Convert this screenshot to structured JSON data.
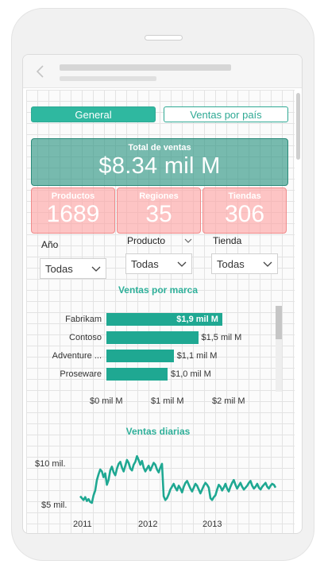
{
  "tabs": {
    "general": "General",
    "ventas_pais": "Ventas por país"
  },
  "kpis": {
    "total": {
      "label": "Total de ventas",
      "value": "$8.34 mil M"
    },
    "productos": {
      "label": "Productos",
      "value": "1689"
    },
    "regiones": {
      "label": "Regiones",
      "value": "35"
    },
    "tiendas": {
      "label": "Tiendas",
      "value": "306"
    }
  },
  "slicers": {
    "anio": {
      "label": "Año",
      "value": "Todas"
    },
    "producto": {
      "label": "Producto",
      "value": "Todas"
    },
    "tienda": {
      "label": "Tienda",
      "value": "Todas"
    }
  },
  "colors": {
    "accent": "#2fb8a0",
    "bar": "#1fa892",
    "kpi_total_bg": "#5fb0a2",
    "kpi_small_bg": "#ffb3b3"
  },
  "chart_data": [
    {
      "type": "bar",
      "title": "Ventas por marca",
      "categories": [
        "Fabrikam",
        "Contoso",
        "Adventure ...",
        "Proseware"
      ],
      "values": [
        1.9,
        1.5,
        1.1,
        1.0
      ],
      "value_labels": [
        "$1,9 mil M",
        "$1,5 mil M",
        "$1,1 mil M",
        "$1,0 mil M"
      ],
      "x_ticks": [
        "$0 mil M",
        "$1 mil M",
        "$2 mil M"
      ],
      "xlim": [
        0,
        2.3
      ],
      "orientation": "horizontal"
    },
    {
      "type": "line",
      "title": "Ventas diarias",
      "y_ticks": [
        "$10 mil.",
        "$5 mil."
      ],
      "x_ticks": [
        "2011",
        "2012",
        "2013"
      ],
      "ylim": [
        4,
        11
      ],
      "series": [
        {
          "values": [
            6.2,
            6.0,
            5.8,
            6.1,
            5.7,
            5.9,
            5.6,
            5.5,
            6.3,
            6.8,
            7.9,
            8.5,
            9.0,
            8.8,
            8.2,
            8.6,
            7.4,
            7.9,
            8.9,
            9.3,
            8.7,
            8.4,
            9.1,
            9.6,
            9.8,
            9.2,
            8.8,
            9.4,
            10.0,
            9.7,
            9.1,
            8.9,
            9.5,
            9.8,
            10.4,
            10.0,
            9.5,
            9.9,
            9.2,
            8.8,
            9.1,
            9.4,
            8.9,
            9.3,
            9.7,
            9.5,
            9.0,
            8.7,
            9.2,
            9.6,
            6.2,
            5.8,
            6.0,
            6.4,
            6.9,
            7.2,
            7.5,
            7.1,
            6.8,
            7.3,
            7.0,
            6.6,
            7.2,
            7.6,
            7.8,
            7.4,
            7.0,
            6.7,
            7.1,
            7.5,
            7.3,
            6.9,
            6.5,
            6.9,
            7.3,
            7.6,
            7.4,
            7.1,
            6.0,
            5.8,
            6.1,
            6.3,
            6.9,
            7.4,
            7.2,
            6.8,
            7.1,
            7.5,
            7.0,
            6.7,
            7.2,
            7.6,
            7.9,
            7.4,
            7.0,
            7.3,
            7.6,
            7.2,
            6.9,
            7.1,
            7.3,
            7.6,
            7.8,
            7.3,
            7.0,
            7.2,
            7.5,
            7.1,
            6.9,
            7.2,
            7.4,
            7.6,
            7.2,
            7.0,
            7.3,
            7.5,
            7.4,
            7.1
          ]
        }
      ]
    }
  ]
}
